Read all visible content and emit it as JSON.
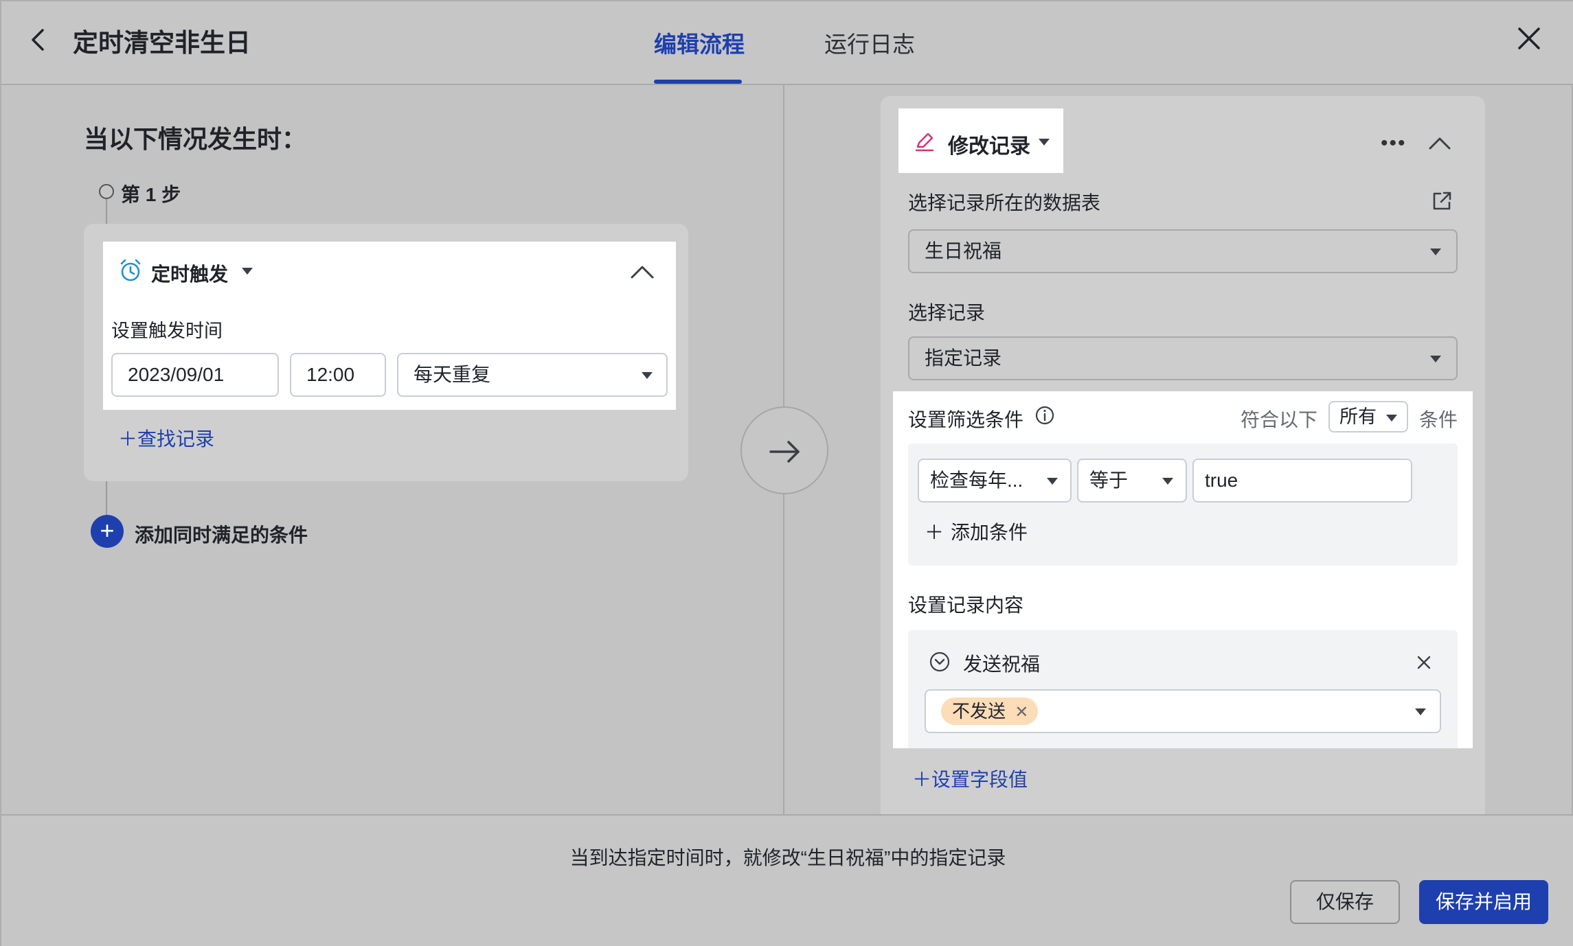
{
  "header": {
    "title": "定时清空非生日",
    "tabs": [
      {
        "label": "编辑流程",
        "active": true
      },
      {
        "label": "运行日志",
        "active": false
      }
    ]
  },
  "trigger": {
    "heading": "当以下情况发生时：",
    "step_label": "第 1 步",
    "title": "定时触发",
    "time_label": "设置触发时间",
    "date": "2023/09/01",
    "time": "12:00",
    "repeat": "每天重复",
    "find_record": "查找记录",
    "add_condition": "添加同时满足的条件"
  },
  "action": {
    "title": "修改记录",
    "table_label": "选择记录所在的数据表",
    "table_value": "生日祝福",
    "record_label": "选择记录",
    "record_value": "指定记录",
    "filter_label": "设置筛选条件",
    "match_prefix": "符合以下",
    "match_value": "所有",
    "match_suffix": "条件",
    "condition": {
      "field": "检查每年...",
      "operator": "等于",
      "value": "true"
    },
    "add_condition": "添加条件",
    "content_label": "设置记录内容",
    "field_name": "发送祝福",
    "field_tag": "不发送",
    "set_field": "设置字段值"
  },
  "footer": {
    "summary": "当到达指定时间时，就修改“生日祝福”中的指定记录",
    "save_label": "仅保存",
    "save_enable_label": "保存并启用"
  },
  "colors": {
    "accent": "#1e3fae",
    "icon_pink": "#d1307a",
    "icon_blue": "#1f8fd6",
    "tag_bg": "#fddcb8"
  },
  "icons": [
    "back-icon",
    "close-icon",
    "alarm-clock-icon",
    "chevron-up-icon",
    "plus-icon",
    "arrow-right-icon",
    "pencil-icon",
    "more-icon",
    "external-link-icon",
    "info-icon",
    "chevron-down-circle-icon",
    "close-small-icon"
  ]
}
